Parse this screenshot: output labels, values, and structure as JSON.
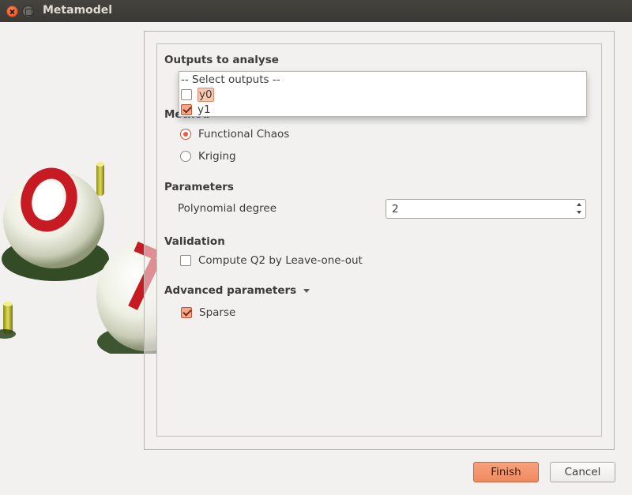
{
  "window": {
    "title": "Metamodel"
  },
  "outputs": {
    "title": "Outputs to analyse",
    "placeholder": "-- Select outputs --",
    "items": [
      {
        "label": "y0",
        "checked": false,
        "highlighted": true
      },
      {
        "label": "y1",
        "checked": true,
        "highlighted": false
      }
    ]
  },
  "method": {
    "title": "Method",
    "options": [
      {
        "label": "Functional Chaos",
        "selected": true
      },
      {
        "label": "Kriging",
        "selected": false
      }
    ]
  },
  "parameters": {
    "title": "Parameters",
    "degree_label": "Polynomial degree",
    "degree_value": "2"
  },
  "validation": {
    "title": "Validation",
    "q2_label": "Compute Q2 by Leave-one-out",
    "q2_checked": false
  },
  "advanced": {
    "title": "Advanced parameters",
    "sparse_label": "Sparse",
    "sparse_checked": true
  },
  "buttons": {
    "finish": "Finish",
    "cancel": "Cancel"
  },
  "colors": {
    "accent": "#ef8a60",
    "titlebar": "#3c3b37",
    "background": "#f2f1f0"
  }
}
